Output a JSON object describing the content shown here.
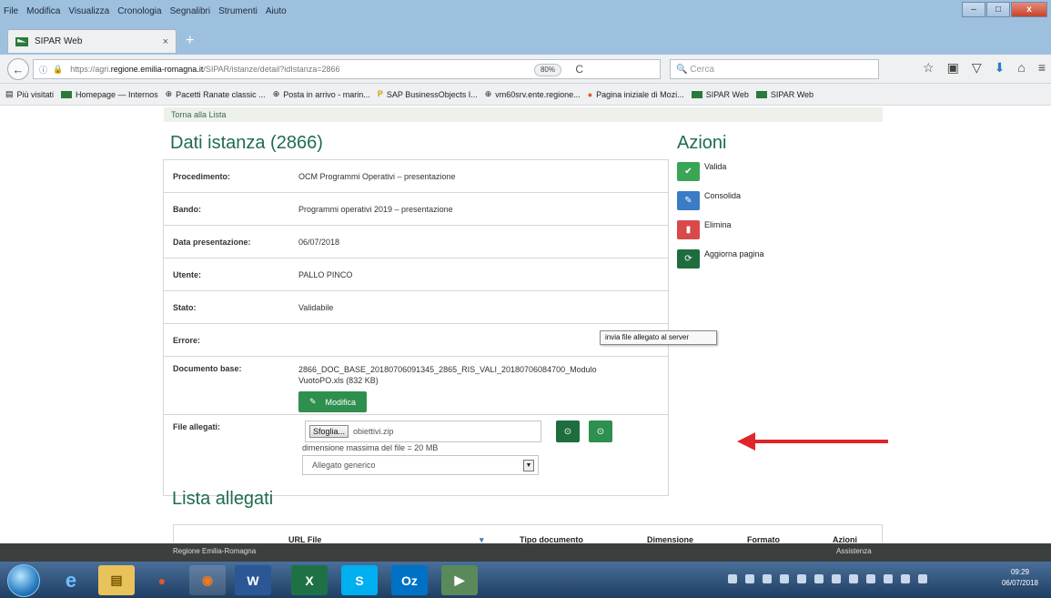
{
  "menubar": {
    "items": [
      "File",
      "Modifica",
      "Visualizza",
      "Cronologia",
      "Segnalibri",
      "Strumenti",
      "Aiuto"
    ],
    "win_minimize": "–",
    "win_maximize": "□",
    "win_close": "x"
  },
  "tab": {
    "title": "SIPAR Web",
    "close": "×",
    "new_tab": "+"
  },
  "nav": {
    "back_icon": "←",
    "info_icon": "ⓘ",
    "lock_icon": "🔒",
    "url_prefix": "https://agri.",
    "url_host": "regione.emilia-romagna.it",
    "url_path": "/SIPAR/istanze/detail?idIstanza=2866",
    "zoom": "80%",
    "reload_icon": "C",
    "search_placeholder": "Cerca",
    "icons": [
      "☆",
      "▣",
      "▽",
      "⬇",
      "⌂",
      "≡"
    ]
  },
  "bookmarks": [
    "Più visitati",
    "Homepage — Internos",
    "Pacetti Ranate classic ...",
    "Posta in arrivo - marin...",
    "SAP BusinessObjects I...",
    "vm60srv.ente.regione...",
    "Pagina iniziale di Mozi...",
    "SIPAR Web",
    "SIPAR Web"
  ],
  "page": {
    "return_link": "Torna alla Lista",
    "title": "Dati istanza (2866)",
    "rows": [
      {
        "label": "Procedimento:",
        "value": "OCM Programmi Operativi – presentazione"
      },
      {
        "label": "Bando:",
        "value": "Programmi operativi 2019 – presentazione"
      },
      {
        "label": "Data presentazione:",
        "value": "06/07/2018"
      },
      {
        "label": "Utente:",
        "value": "PALLO PINCO"
      },
      {
        "label": "Stato:",
        "value": "Validabile"
      },
      {
        "label": "Errore:",
        "value": ""
      }
    ],
    "documento_base_label": "Documento base:",
    "documento_base_value": "2866_DOC_BASE_20180706091345_2865_RIS_VALI_20180706084700_ModuloVuotoPO.xls (832 KB)",
    "modifica_label": "Modifica",
    "file_allegati_label": "File allegati:",
    "sfoglia_label": "Sfoglia...",
    "file_name": "obiettivi.zip",
    "max_size": "dimensione massima del file = 20 MB",
    "select_value": "Allegato generico",
    "tooltip": "invia file allegato al server",
    "lista_title": "Lista allegati",
    "lista_columns": [
      "URL File",
      "Tipo documento",
      "Dimensione",
      "Formato",
      "Azioni"
    ]
  },
  "azioni": {
    "title": "Azioni",
    "items": [
      {
        "label": "Valida",
        "icon": "✔",
        "color": "#3aa655"
      },
      {
        "label": "Consolida",
        "icon": "✎",
        "color": "#3b7cc6"
      },
      {
        "label": "Elimina",
        "icon": "▮",
        "color": "#d84a4a"
      },
      {
        "label": "Aggiorna pagina",
        "icon": "⟳",
        "color": "#1f6d3d"
      }
    ]
  },
  "footer": {
    "left": "Regione Emilia-Romagna",
    "right": "Assistenza"
  },
  "taskbar": {
    "apps": [
      "e",
      "▤",
      "●",
      "◉",
      "W",
      "X",
      "S",
      "Oz",
      "▶"
    ],
    "time": "09:29",
    "date": "06/07/2018"
  }
}
